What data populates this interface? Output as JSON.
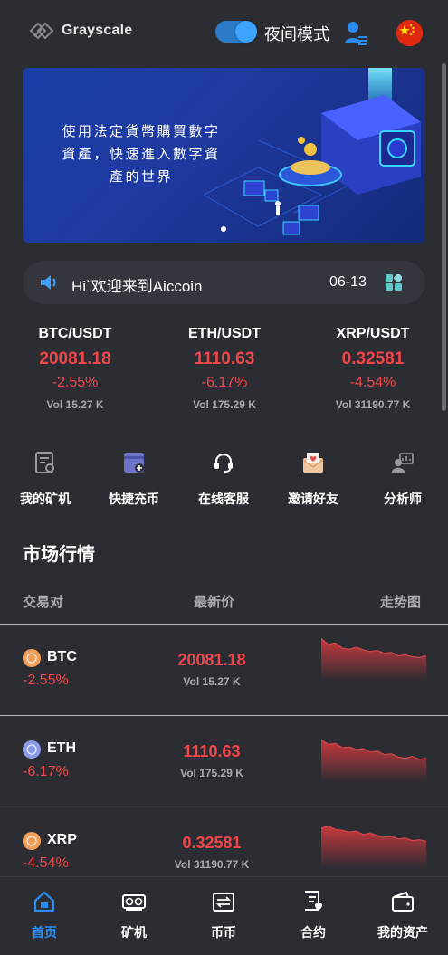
{
  "header": {
    "logo_text": "Grayscale",
    "night_mode_label": "夜间模式",
    "night_mode_on": true
  },
  "banner": {
    "text": "使用法定貨幣購買數字資產，快速進入數字資產的世界"
  },
  "notice": {
    "text": "Hi`欢迎来到Aiccoin",
    "date": "06-13"
  },
  "tickers": [
    {
      "pair": "BTC/USDT",
      "price": "20081.18",
      "change": "-2.55%",
      "vol": "Vol 15.27 K"
    },
    {
      "pair": "ETH/USDT",
      "price": "1110.63",
      "change": "-6.17%",
      "vol": "Vol 175.29 K"
    },
    {
      "pair": "XRP/USDT",
      "price": "0.32581",
      "change": "-4.54%",
      "vol": "Vol 31190.77 K"
    }
  ],
  "quick_menu": [
    {
      "label": "我的矿机",
      "icon": "miner-doc-icon"
    },
    {
      "label": "快捷充币",
      "icon": "quick-deposit-icon"
    },
    {
      "label": "在线客服",
      "icon": "headset-icon"
    },
    {
      "label": "邀请好友",
      "icon": "invite-envelope-icon"
    },
    {
      "label": "分析师",
      "icon": "analyst-icon"
    }
  ],
  "market": {
    "title": "市场行情",
    "columns": [
      "交易对",
      "最新价",
      "走势图"
    ],
    "rows": [
      {
        "name": "BTC",
        "change": "-2.55%",
        "price": "20081.18",
        "vol": "Vol 15.27 K",
        "icon_color": "#f0a05a",
        "trend": [
          1.0,
          0.86,
          0.9,
          0.78,
          0.75,
          0.8,
          0.74,
          0.7,
          0.72,
          0.66,
          0.68,
          0.6,
          0.62,
          0.58,
          0.56,
          0.6
        ]
      },
      {
        "name": "ETH",
        "change": "-6.17%",
        "price": "1110.63",
        "vol": "Vol 175.29 K",
        "icon_color": "#8c9be8",
        "trend": [
          1.0,
          0.9,
          0.92,
          0.82,
          0.84,
          0.78,
          0.8,
          0.72,
          0.74,
          0.66,
          0.68,
          0.6,
          0.58,
          0.62,
          0.55,
          0.57
        ]
      },
      {
        "name": "XRP",
        "change": "-4.54%",
        "price": "0.32581",
        "vol": "Vol 31190.77 K",
        "icon_color": "#f0a05a",
        "trend": [
          0.95,
          1.0,
          0.92,
          0.9,
          0.86,
          0.88,
          0.8,
          0.84,
          0.78,
          0.74,
          0.76,
          0.7,
          0.72,
          0.66,
          0.68,
          0.64
        ]
      }
    ]
  },
  "bottom_nav": [
    {
      "label": "首页",
      "icon": "home-icon",
      "active": true
    },
    {
      "label": "矿机",
      "icon": "miner-icon",
      "active": false
    },
    {
      "label": "币币",
      "icon": "exchange-icon",
      "active": false
    },
    {
      "label": "合约",
      "icon": "contract-icon",
      "active": false
    },
    {
      "label": "我的资产",
      "icon": "wallet-icon",
      "active": false
    }
  ],
  "colors": {
    "background": "#2b2d33",
    "down": "#f1474b",
    "accent": "#2a8cf0",
    "muted": "#a9abb0"
  }
}
